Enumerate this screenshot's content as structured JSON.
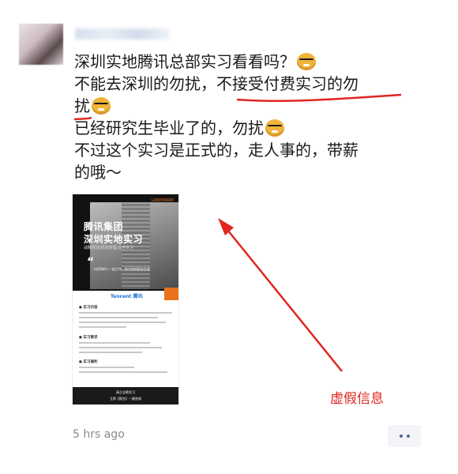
{
  "post": {
    "lines": [
      "深圳实地腾讯总部实习看看吗？",
      "不能去深圳的勿扰，",
      "不接受付费实习的勿",
      "扰",
      "已经研究生毕业了的，勿扰",
      "不过这个实习是正式的，走人事的，带薪",
      "的哦～"
    ],
    "emojis": [
      "doge-emoji",
      "doge-emoji",
      "doge-emoji"
    ],
    "timestamp": "5 hrs ago"
  },
  "poster": {
    "logo_text": "LANDMARK",
    "title_line1": "腾讯集团",
    "title_line2": "深圳实地实习",
    "subtitle": "战略规划/项目管理/业务实习",
    "quote_mark": "“",
    "quote_text": "与优秀的人一起工作，助力你的职业生涯",
    "brand": "Tencent 腾讯",
    "section1": "● 实习内容",
    "section2": "● 实习要求",
    "section3": "● 实习福利",
    "bottom_line1": "高企全薪实习",
    "bottom_line2": "立即【报名】一键咨询"
  },
  "annotation": {
    "text": "虚假信息",
    "color": "#e0261f"
  },
  "colors": {
    "annotation_red": "#e0261f",
    "timestamp_gray": "#8a8a8a",
    "more_dots": "#4f6796"
  }
}
